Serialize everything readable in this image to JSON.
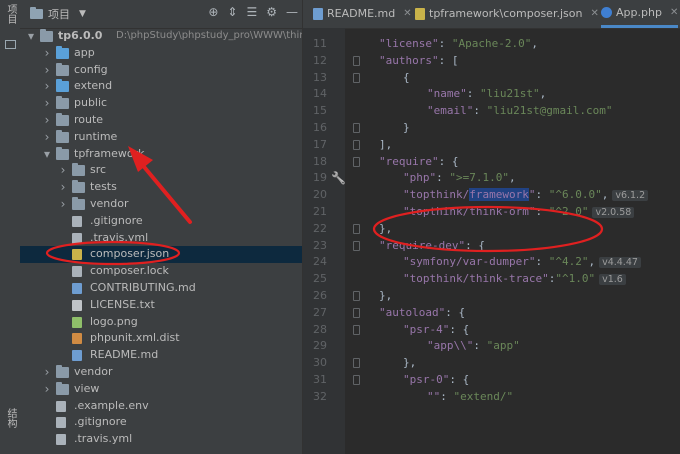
{
  "strip": {
    "top_label": "项目",
    "bottom_label": "结构"
  },
  "project": {
    "title": "项目",
    "items": [
      {
        "label": "tp6.0.0",
        "path": "D:\\phpStudy\\phpstudy_pro\\WWW\\thinkphp",
        "indent": 0,
        "arrow": "down",
        "icon": "folder",
        "bold": true
      },
      {
        "label": "app",
        "indent": 1,
        "arrow": "right",
        "icon": "folder-blue"
      },
      {
        "label": "config",
        "indent": 1,
        "arrow": "right",
        "icon": "folder"
      },
      {
        "label": "extend",
        "indent": 1,
        "arrow": "right",
        "icon": "folder-blue"
      },
      {
        "label": "public",
        "indent": 1,
        "arrow": "right",
        "icon": "folder"
      },
      {
        "label": "route",
        "indent": 1,
        "arrow": "right",
        "icon": "folder"
      },
      {
        "label": "runtime",
        "indent": 1,
        "arrow": "right",
        "icon": "folder"
      },
      {
        "label": "tpframework",
        "indent": 1,
        "arrow": "down",
        "icon": "folder"
      },
      {
        "label": "src",
        "indent": 2,
        "arrow": "right",
        "icon": "folder"
      },
      {
        "label": "tests",
        "indent": 2,
        "arrow": "right",
        "icon": "folder"
      },
      {
        "label": "vendor",
        "indent": 2,
        "arrow": "right",
        "icon": "folder"
      },
      {
        "label": ".gitignore",
        "indent": 2,
        "arrow": "",
        "icon": "file"
      },
      {
        "label": ".travis.yml",
        "indent": 2,
        "arrow": "",
        "icon": "file"
      },
      {
        "label": "composer.json",
        "indent": 2,
        "arrow": "",
        "icon": "json",
        "selected": true
      },
      {
        "label": "composer.lock",
        "indent": 2,
        "arrow": "",
        "icon": "file"
      },
      {
        "label": "CONTRIBUTING.md",
        "indent": 2,
        "arrow": "",
        "icon": "md"
      },
      {
        "label": "LICENSE.txt",
        "indent": 2,
        "arrow": "",
        "icon": "txt"
      },
      {
        "label": "logo.png",
        "indent": 2,
        "arrow": "",
        "icon": "img"
      },
      {
        "label": "phpunit.xml.dist",
        "indent": 2,
        "arrow": "",
        "icon": "xml"
      },
      {
        "label": "README.md",
        "indent": 2,
        "arrow": "",
        "icon": "md"
      },
      {
        "label": "vendor",
        "indent": 1,
        "arrow": "right",
        "icon": "folder"
      },
      {
        "label": "view",
        "indent": 1,
        "arrow": "right",
        "icon": "folder"
      },
      {
        "label": ".example.env",
        "indent": 1,
        "arrow": "",
        "icon": "file"
      },
      {
        "label": ".gitignore",
        "indent": 1,
        "arrow": "",
        "icon": "file"
      },
      {
        "label": ".travis.yml",
        "indent": 1,
        "arrow": "",
        "icon": "file"
      }
    ]
  },
  "tabs": [
    {
      "label": "README.md",
      "icon": "md",
      "active": false
    },
    {
      "label": "tpframework\\composer.json",
      "icon": "json",
      "active": false
    },
    {
      "label": "App.php",
      "icon": "php",
      "active": true
    }
  ],
  "editor": {
    "lines": [
      {
        "n": "11",
        "ind": 1,
        "parts": [
          [
            "k",
            "\"license\""
          ],
          [
            "b",
            ": "
          ],
          [
            "s",
            "\"Apache-2.0\""
          ],
          [
            "b",
            ","
          ]
        ]
      },
      {
        "n": "12",
        "ind": 1,
        "parts": [
          [
            "k",
            "\"authors\""
          ],
          [
            "b",
            ": ["
          ]
        ],
        "fold": true
      },
      {
        "n": "13",
        "ind": 2,
        "parts": [
          [
            "b",
            "{"
          ]
        ],
        "fold": true
      },
      {
        "n": "14",
        "ind": 3,
        "parts": [
          [
            "k",
            "\"name\""
          ],
          [
            "b",
            ": "
          ],
          [
            "s",
            "\"liu21st\""
          ],
          [
            "b",
            ","
          ]
        ]
      },
      {
        "n": "15",
        "ind": 3,
        "parts": [
          [
            "k",
            "\"email\""
          ],
          [
            "b",
            ": "
          ],
          [
            "s",
            "\"liu21st@gmail.com\""
          ]
        ]
      },
      {
        "n": "16",
        "ind": 2,
        "parts": [
          [
            "b",
            "}"
          ]
        ],
        "fold": true
      },
      {
        "n": "17",
        "ind": 1,
        "parts": [
          [
            "b",
            "],"
          ]
        ],
        "fold": true
      },
      {
        "n": "18",
        "ind": 1,
        "parts": [
          [
            "k",
            "\"require\""
          ],
          [
            "b",
            ": {"
          ]
        ],
        "fold": true
      },
      {
        "n": "19",
        "ind": 2,
        "parts": [
          [
            "k",
            "\"php\""
          ],
          [
            "b",
            ": "
          ],
          [
            "s",
            "\">=7.1.0\""
          ],
          [
            "b",
            ","
          ]
        ]
      },
      {
        "n": "20",
        "ind": 2,
        "parts": [
          [
            "k",
            "\"topthink/"
          ],
          [
            "hl",
            "framework"
          ],
          [
            "k",
            "\""
          ],
          [
            "b",
            ": "
          ],
          [
            "s",
            "\"^6.0.0\""
          ],
          [
            "b",
            ","
          ]
        ],
        "hint": "v6.1.2"
      },
      {
        "n": "21",
        "ind": 2,
        "parts": [
          [
            "k",
            "\"topthink/think-orm\""
          ],
          [
            "b",
            ": "
          ],
          [
            "s",
            "\"^2.0\""
          ]
        ],
        "hint": "v2.0.58"
      },
      {
        "n": "22",
        "ind": 1,
        "parts": [
          [
            "b",
            "},"
          ]
        ],
        "fold": true
      },
      {
        "n": "23",
        "ind": 1,
        "parts": [
          [
            "k",
            "\"require-dev\""
          ],
          [
            "b",
            ": {"
          ]
        ],
        "fold": true
      },
      {
        "n": "24",
        "ind": 2,
        "parts": [
          [
            "k",
            "\"symfony/var-dumper\""
          ],
          [
            "b",
            ": "
          ],
          [
            "s",
            "\"^4.2\""
          ],
          [
            "b",
            ","
          ]
        ],
        "hint": "v4.4.47"
      },
      {
        "n": "25",
        "ind": 2,
        "parts": [
          [
            "k",
            "\"topthink/think-trace\""
          ],
          [
            "b",
            ":"
          ],
          [
            "s",
            "\"^1.0\""
          ]
        ],
        "hint": "v1.6"
      },
      {
        "n": "26",
        "ind": 1,
        "parts": [
          [
            "b",
            "},"
          ]
        ],
        "fold": true
      },
      {
        "n": "27",
        "ind": 1,
        "parts": [
          [
            "k",
            "\"autoload\""
          ],
          [
            "b",
            ": {"
          ]
        ],
        "fold": true
      },
      {
        "n": "28",
        "ind": 2,
        "parts": [
          [
            "k",
            "\"psr-4\""
          ],
          [
            "b",
            ": {"
          ]
        ],
        "fold": true
      },
      {
        "n": "29",
        "ind": 3,
        "parts": [
          [
            "k",
            "\"app\\\\\""
          ],
          [
            "b",
            ": "
          ],
          [
            "s",
            "\"app\""
          ]
        ]
      },
      {
        "n": "30",
        "ind": 2,
        "parts": [
          [
            "b",
            "},"
          ]
        ],
        "fold": true
      },
      {
        "n": "31",
        "ind": 2,
        "parts": [
          [
            "k",
            "\"psr-0\""
          ],
          [
            "b",
            ": {"
          ]
        ],
        "fold": true
      },
      {
        "n": "32",
        "ind": 3,
        "parts": [
          [
            "k",
            "\"\""
          ],
          [
            "b",
            ": "
          ],
          [
            "s",
            "\"extend/\""
          ]
        ]
      }
    ]
  }
}
